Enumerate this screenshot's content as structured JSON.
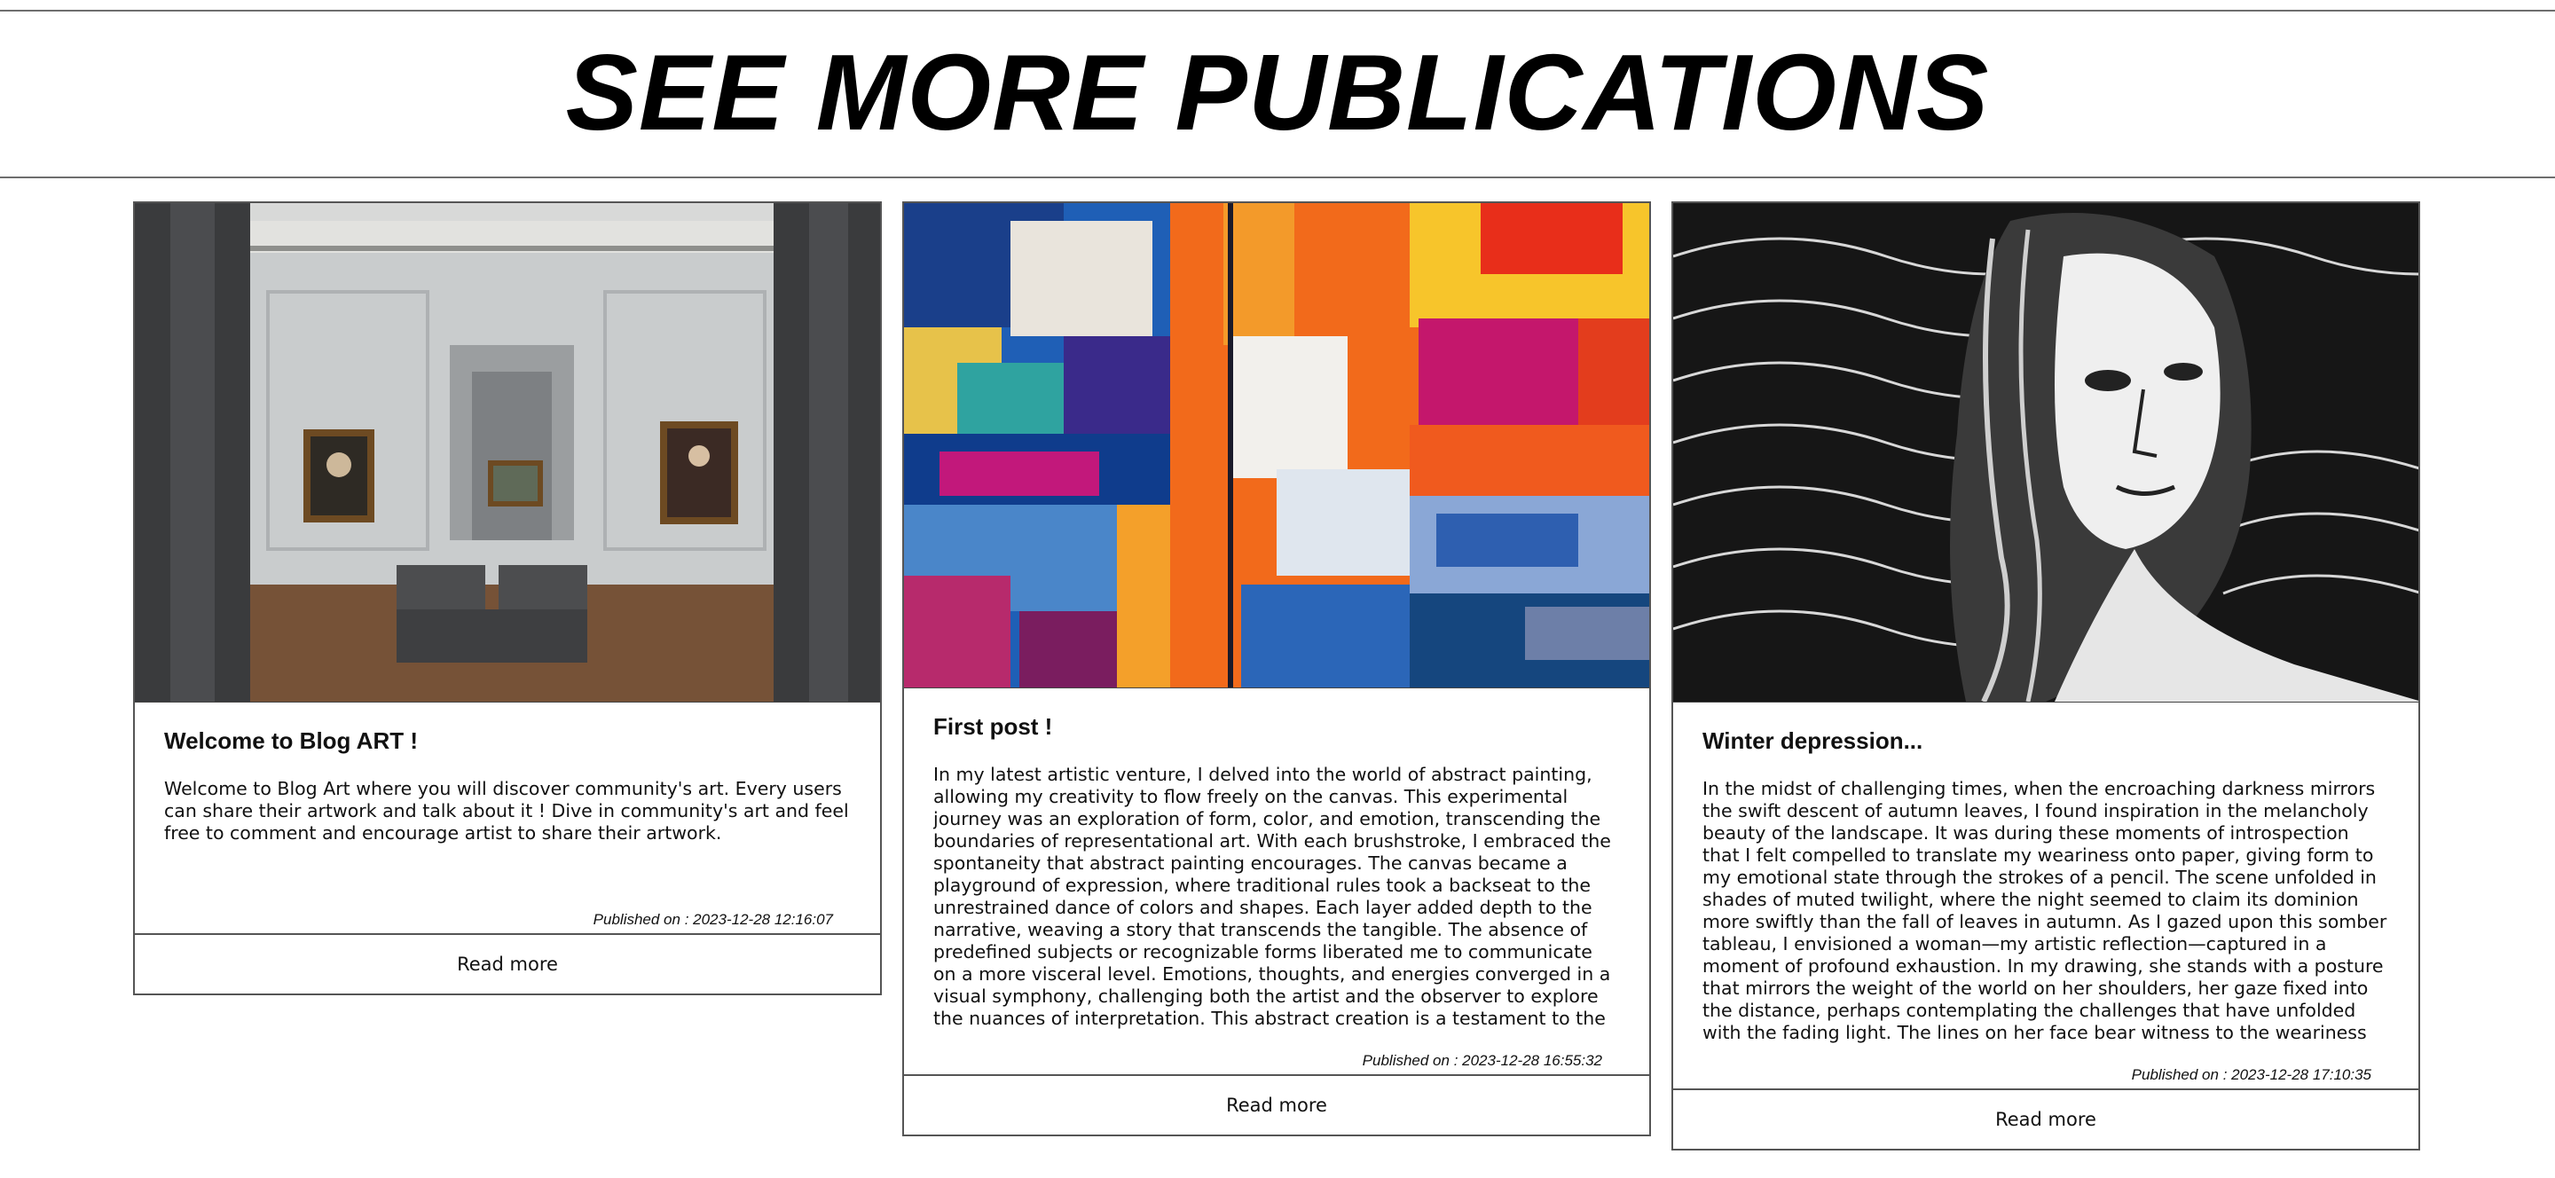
{
  "header": {
    "title": "SEE MORE PUBLICATIONS"
  },
  "posts": [
    {
      "title": "Welcome to Blog ART !",
      "text": "Welcome to Blog Art where you will discover community's art. Every users can share their artwork and talk about it ! Dive in community's art and feel free to comment and encourage artist to share their artwork.",
      "date": "Published on : 2023-12-28 12:16:07",
      "read_more": "Read more",
      "image": "museum-gallery-image"
    },
    {
      "title": "First post !",
      "text": "In my latest artistic venture, I delved into the world of abstract painting, allowing my creativity to flow freely on the canvas. This experimental journey was an exploration of form, color, and emotion, transcending the boundaries of representational art. With each brushstroke, I embraced the spontaneity that abstract painting encourages. The canvas became a playground of expression, where traditional rules took a backseat to the unrestrained dance of colors and shapes. Each layer added depth to the narrative, weaving a story that transcends the tangible. The absence of predefined subjects or recognizable forms liberated me to communicate on a more visceral level. Emotions, thoughts, and energies converged in a visual symphony, challenging both the artist and the observer to explore the nuances of interpretation. This abstract creation is a testament to the power of experimentation in art, a departure from",
      "date": "Published on : 2023-12-28 16:55:32",
      "read_more": "Read more",
      "image": "abstract-painting-image"
    },
    {
      "title": "Winter depression...",
      "text": "In the midst of challenging times, when the encroaching darkness mirrors the swift descent of autumn leaves, I found inspiration in the melancholy beauty of the landscape. It was during these moments of introspection that I felt compelled to translate my weariness onto paper, giving form to my emotional state through the strokes of a pencil. The scene unfolded in shades of muted twilight, where the night seemed to claim its dominion more swiftly than the fall of leaves in autumn. As I gazed upon this somber tableau, I envisioned a woman—my artistic reflection—captured in a moment of profound exhaustion. In my drawing, she stands with a posture that mirrors the weight of the world on her shoulders, her gaze fixed into the distance, perhaps contemplating the challenges that have unfolded with the fading light. The lines on her face bear witness to the weariness that clings to her, etched by the trials and tribulations",
      "date": "Published on : 2023-12-28 17:10:35",
      "read_more": "Read more",
      "image": "woman-drawing-image"
    }
  ]
}
